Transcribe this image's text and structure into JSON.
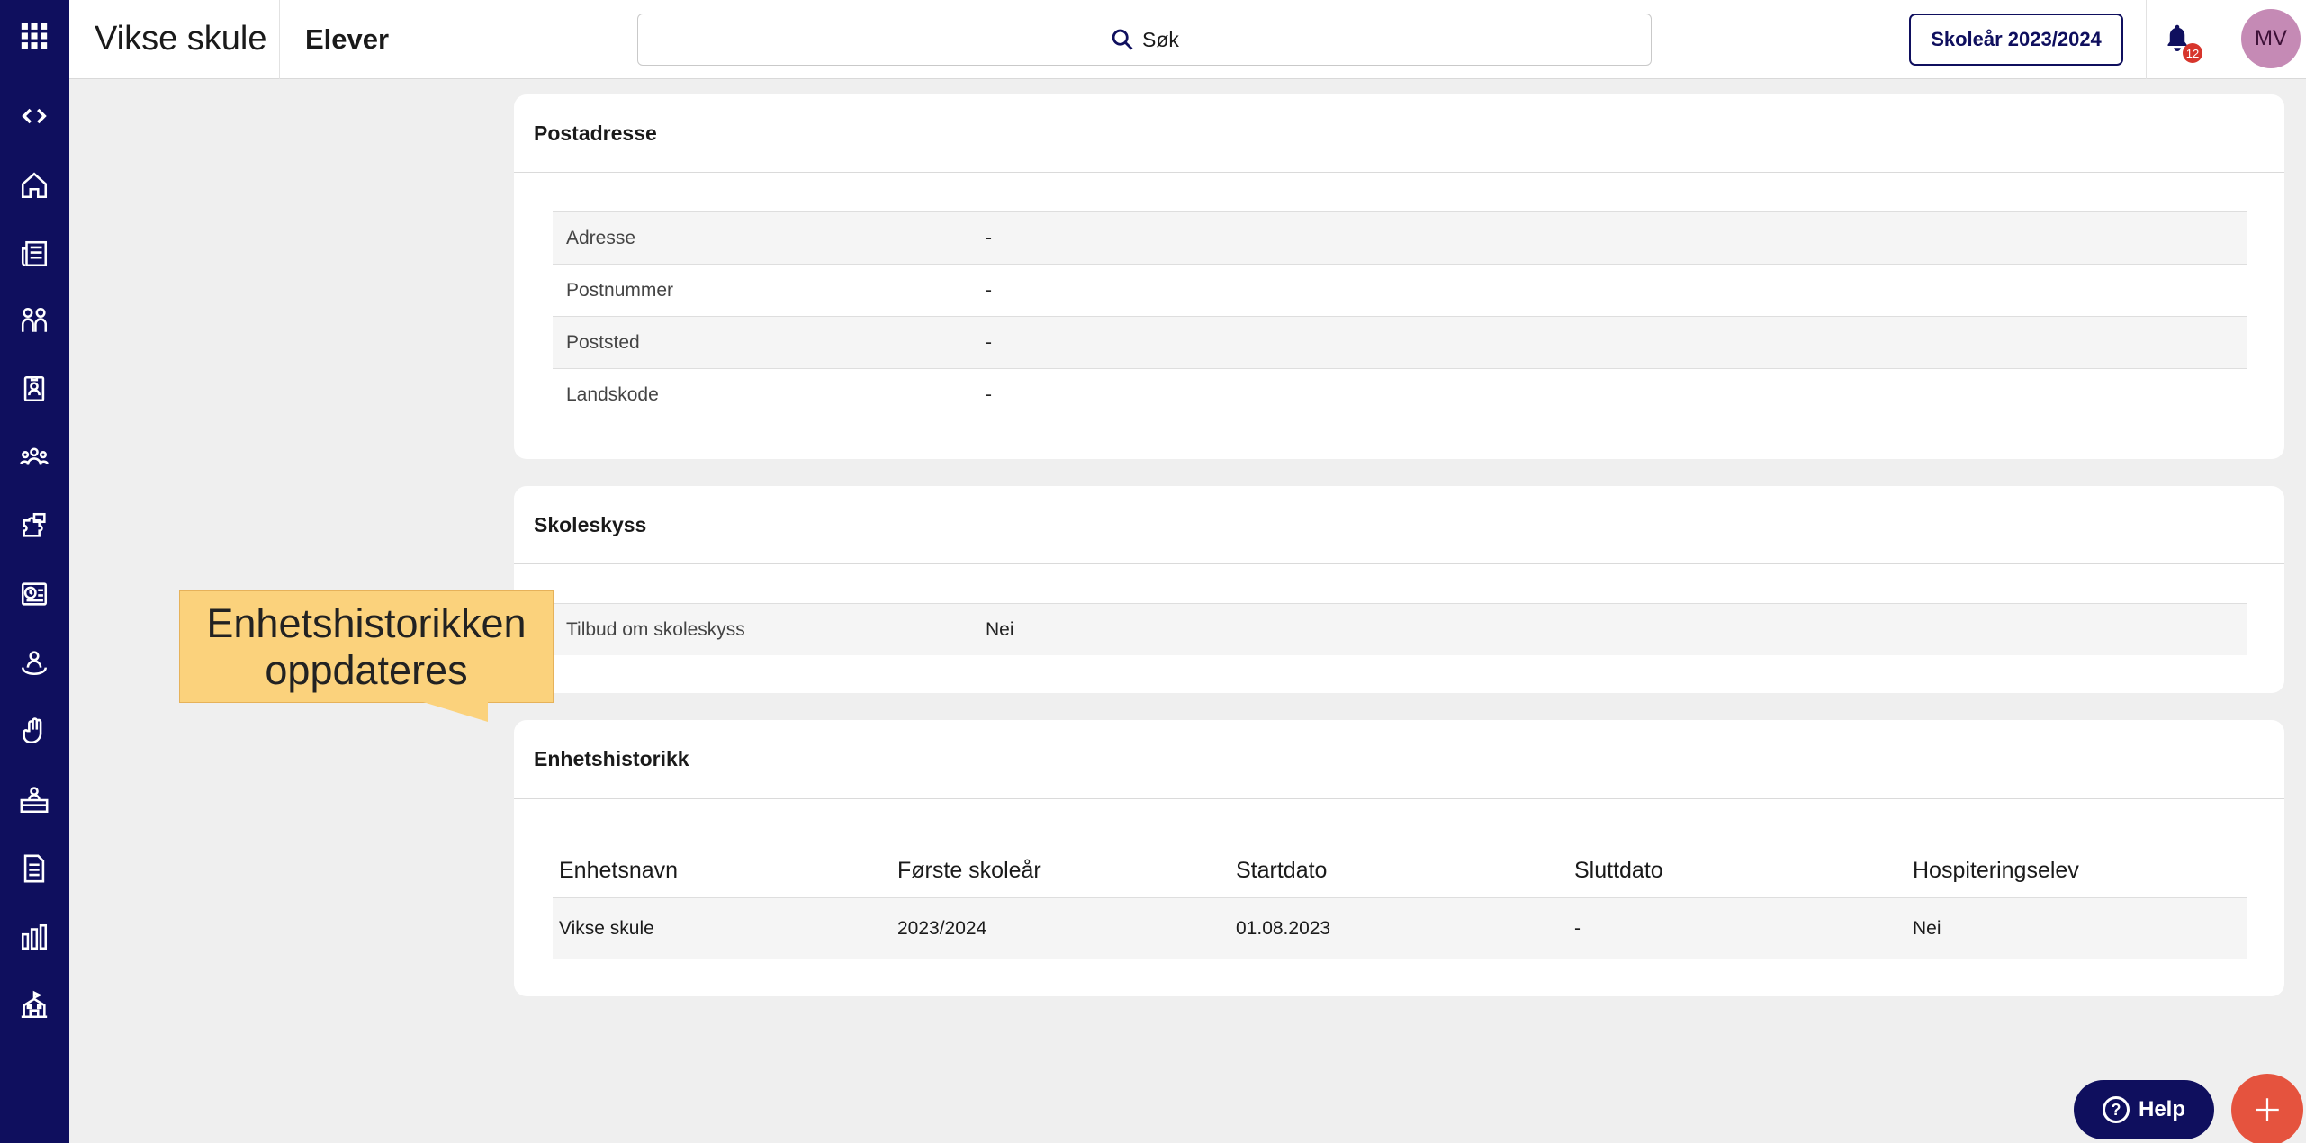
{
  "header": {
    "app_title": "Vikse skule",
    "page_title": "Elever",
    "search_label": "Søk",
    "school_year_button": "Skoleår 2023/2024",
    "notification_count": "12",
    "avatar_initials": "MV"
  },
  "sidebar": {
    "icons": [
      "apps-grid-icon",
      "collapse-toggle-icon",
      "home-icon",
      "news-icon",
      "students-icon",
      "badge-icon",
      "groups-icon",
      "puzzle-icon",
      "schedule-icon",
      "person-circle-icon",
      "hand-icon",
      "desk-icon",
      "document-icon",
      "chart-icon",
      "school-icon"
    ]
  },
  "postadresse": {
    "title": "Postadresse",
    "rows": [
      {
        "label": "Adresse",
        "value": "-"
      },
      {
        "label": "Postnummer",
        "value": "-"
      },
      {
        "label": "Poststed",
        "value": "-"
      },
      {
        "label": "Landskode",
        "value": "-"
      }
    ]
  },
  "skoleskyss": {
    "title": "Skoleskyss",
    "rows": [
      {
        "label": "Tilbud om skoleskyss",
        "value": "Nei"
      }
    ]
  },
  "enhetshistorikk": {
    "title": "Enhetshistorikk",
    "columns": [
      "Enhetsnavn",
      "Første skoleår",
      "Startdato",
      "Sluttdato",
      "Hospiteringselev"
    ],
    "rows": [
      [
        "Vikse skule",
        "2023/2024",
        "01.08.2023",
        "-",
        "Nei"
      ]
    ]
  },
  "callout": {
    "line1": "Enhetshistorikken",
    "line2": "oppdateres"
  },
  "help_button": "Help",
  "colors": {
    "sidebar": "#0f0f5e",
    "accent_fab": "#e5533e",
    "callout": "#fbd27c",
    "badge": "#d7352c"
  }
}
